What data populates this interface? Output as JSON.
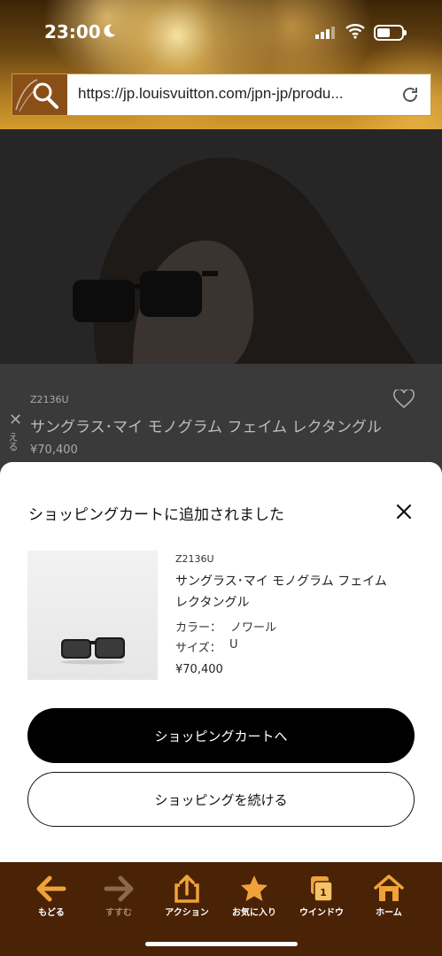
{
  "status": {
    "time": "23:00"
  },
  "browser": {
    "url": "https://jp.louisvuitton.com/jpn-jp/produ..."
  },
  "background_page": {
    "sku": "Z2136U",
    "title": "サングラス･マイ モノグラム フェイム レクタングル",
    "price": "¥70,400",
    "side_text": "える"
  },
  "sheet": {
    "title": "ショッピングカートに追加されました",
    "item": {
      "sku": "Z2136U",
      "name": "サングラス･マイ モノグラム フェイム レクタングル",
      "color_label": "カラー：",
      "color_value": "ノワール",
      "size_label": "サイズ：",
      "size_value": "U",
      "price": "¥70,400"
    },
    "primary_button": "ショッピングカートへ",
    "secondary_button": "ショッピングを続ける"
  },
  "toolbar": {
    "items": [
      {
        "label": "もどる",
        "icon": "back-arrow-icon",
        "enabled": true
      },
      {
        "label": "すすむ",
        "icon": "forward-arrow-icon",
        "enabled": false
      },
      {
        "label": "アクション",
        "icon": "share-icon",
        "enabled": true
      },
      {
        "label": "お気に入り",
        "icon": "star-icon",
        "enabled": true
      },
      {
        "label": "ウインドウ",
        "icon": "windows-icon",
        "enabled": true,
        "badge": "1"
      },
      {
        "label": "ホーム",
        "icon": "home-icon",
        "enabled": true
      }
    ]
  },
  "colors": {
    "accent_brown": "#4a2206",
    "icon_orange": "#f0a23a",
    "button_black": "#000000"
  }
}
